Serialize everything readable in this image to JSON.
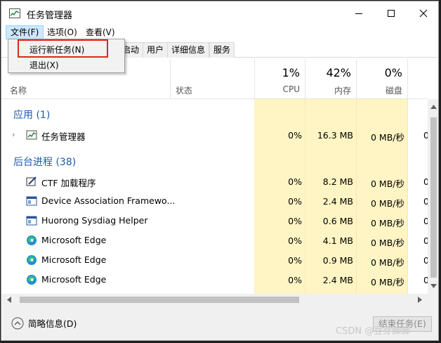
{
  "window": {
    "title": "任务管理器",
    "controls": {
      "minimize": "minimize-icon",
      "maximize": "maximize-icon",
      "close": "close-icon"
    }
  },
  "menubar": [
    {
      "label": "文件(F)"
    },
    {
      "label": "选项(O)"
    },
    {
      "label": "查看(V)"
    }
  ],
  "file_menu": {
    "items": [
      {
        "label": "运行新任务(N)"
      },
      {
        "label": "退出(X)"
      }
    ]
  },
  "tabs": [
    {
      "label": "启动"
    },
    {
      "label": "用户"
    },
    {
      "label": "详细信息"
    },
    {
      "label": "服务"
    }
  ],
  "columns": {
    "name": "名称",
    "status": "状态",
    "cpu": {
      "label": "CPU",
      "percent": "1%"
    },
    "memory": {
      "label": "内存",
      "percent": "42%"
    },
    "disk": {
      "label": "磁盘",
      "percent": "0%"
    }
  },
  "groups": {
    "apps": {
      "title": "应用 (1)"
    },
    "background": {
      "title": "后台进程 (38)"
    }
  },
  "app_rows": [
    {
      "name": "任务管理器",
      "icon": "task-manager-icon",
      "cpu": "0%",
      "memory": "16.3 MB",
      "disk": "0 MB/秒",
      "extra": "0"
    }
  ],
  "bg_rows": [
    {
      "name": "CTF 加载程序",
      "icon": "ctf-loader-icon",
      "cpu": "0%",
      "memory": "8.2 MB",
      "disk": "0 MB/秒",
      "extra": "0"
    },
    {
      "name": "Device Association Framewo...",
      "icon": "window-app-icon",
      "cpu": "0%",
      "memory": "2.4 MB",
      "disk": "0 MB/秒",
      "extra": "0"
    },
    {
      "name": "Huorong Sysdiag Helper",
      "icon": "window-app-icon",
      "cpu": "0%",
      "memory": "0.6 MB",
      "disk": "0 MB/秒",
      "extra": "0"
    },
    {
      "name": "Microsoft Edge",
      "icon": "edge-icon",
      "cpu": "0%",
      "memory": "4.1 MB",
      "disk": "0 MB/秒",
      "extra": "0"
    },
    {
      "name": "Microsoft Edge",
      "icon": "edge-icon",
      "cpu": "0%",
      "memory": "0.9 MB",
      "disk": "0 MB/秒",
      "extra": "0"
    },
    {
      "name": "Microsoft Edge",
      "icon": "edge-icon",
      "cpu": "0%",
      "memory": "2.4 MB",
      "disk": "0 MB/秒",
      "extra": "0"
    }
  ],
  "footer": {
    "fewer_details": "简略信息(D)",
    "end_task": "结束任务(E)"
  },
  "watermark": "CSDN @豆芽脚脚",
  "colors": {
    "group_title": "#1e5aa8",
    "usage_cell": "#fff4c4",
    "highlight_border": "#e1251b",
    "menu_active": "#cce8ff"
  }
}
